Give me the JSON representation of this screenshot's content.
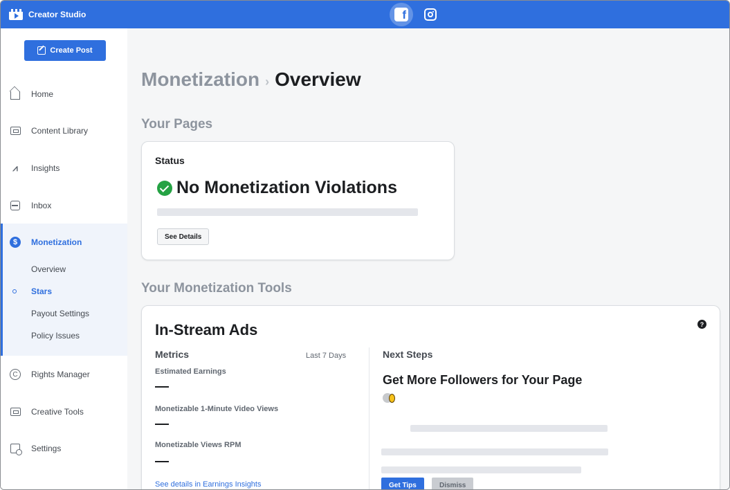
{
  "app": {
    "title": "Creator Studio",
    "platforms": [
      {
        "name": "facebook-icon",
        "active": true
      },
      {
        "name": "instagram-icon",
        "active": false
      }
    ],
    "accent_color": "#2f6fde"
  },
  "sidebar": {
    "create_post_label": "Create Post",
    "items": [
      {
        "label": "Home",
        "icon": "home-icon"
      },
      {
        "label": "Content Library",
        "icon": "content-library-icon"
      },
      {
        "label": "Insights",
        "icon": "insights-icon"
      },
      {
        "label": "Inbox",
        "icon": "inbox-icon"
      },
      {
        "label": "Monetization",
        "icon": "dollar-icon",
        "active": true
      },
      {
        "label": "Rights Manager",
        "icon": "copyright-icon"
      },
      {
        "label": "Creative Tools",
        "icon": "creative-tools-icon"
      },
      {
        "label": "Settings",
        "icon": "settings-icon"
      }
    ],
    "monetization_subitems": [
      {
        "label": "Overview"
      },
      {
        "label": "Stars",
        "active": true
      },
      {
        "label": "Payout Settings"
      },
      {
        "label": "Policy Issues"
      }
    ]
  },
  "main": {
    "breadcrumb": {
      "parent": "Monetization",
      "separator": "›",
      "current": "Overview"
    },
    "pages_section_title": "Your Pages",
    "status_card": {
      "label": "Status",
      "status_text": "No Monetization Violations",
      "status_color": "#25a244",
      "button_label": "See Details"
    },
    "tools_section_title": "Your Monetization Tools",
    "tools_card": {
      "title": "In-Stream Ads",
      "help_label": "?",
      "metrics_heading": "Metrics",
      "period": "Last 7 Days",
      "metrics": [
        {
          "label": "Estimated Earnings",
          "value": "—"
        },
        {
          "label": "Monetizable 1-Minute Video Views",
          "value": "—"
        },
        {
          "label": "Monetizable  Views RPM",
          "value": "—"
        }
      ],
      "details_link": "See details in Earnings Insights",
      "next_steps_heading": "Next Steps",
      "next_steps_title": "Get More Followers for Your Page",
      "primary_button": "Get Tips",
      "secondary_button": "Dismiss"
    }
  }
}
